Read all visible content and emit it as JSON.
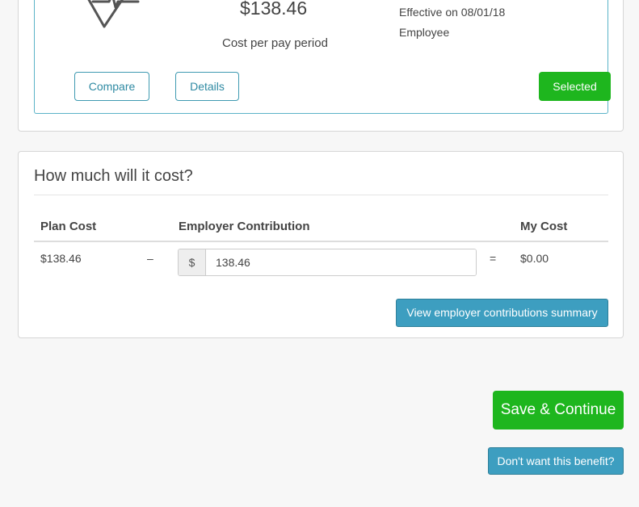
{
  "plan": {
    "icon": "heart-rate-icon",
    "price": "$138.46",
    "cost_label": "Cost per pay period",
    "effective": "Effective on 08/01/18",
    "coverage": "Employee",
    "compare_label": "Compare",
    "details_label": "Details",
    "selected_label": "Selected"
  },
  "cost": {
    "title": "How much will it cost?",
    "headers": {
      "plan_cost": "Plan Cost",
      "employer_contribution": "Employer Contribution",
      "my_cost": "My Cost"
    },
    "plan_cost_value": "$138.46",
    "minus_sign": "–",
    "currency_addon": "$",
    "employer_contribution_value": "138.46",
    "equals_sign": "=",
    "my_cost_value": "$0.00",
    "summary_button": "View employer contributions summary"
  },
  "actions": {
    "save_label": "Save & Continue",
    "decline_label": "Don't want this benefit?"
  },
  "colors": {
    "green": "#1eb61e",
    "blue": "#3d9ec0",
    "teal_outline": "#3f9ab1"
  }
}
